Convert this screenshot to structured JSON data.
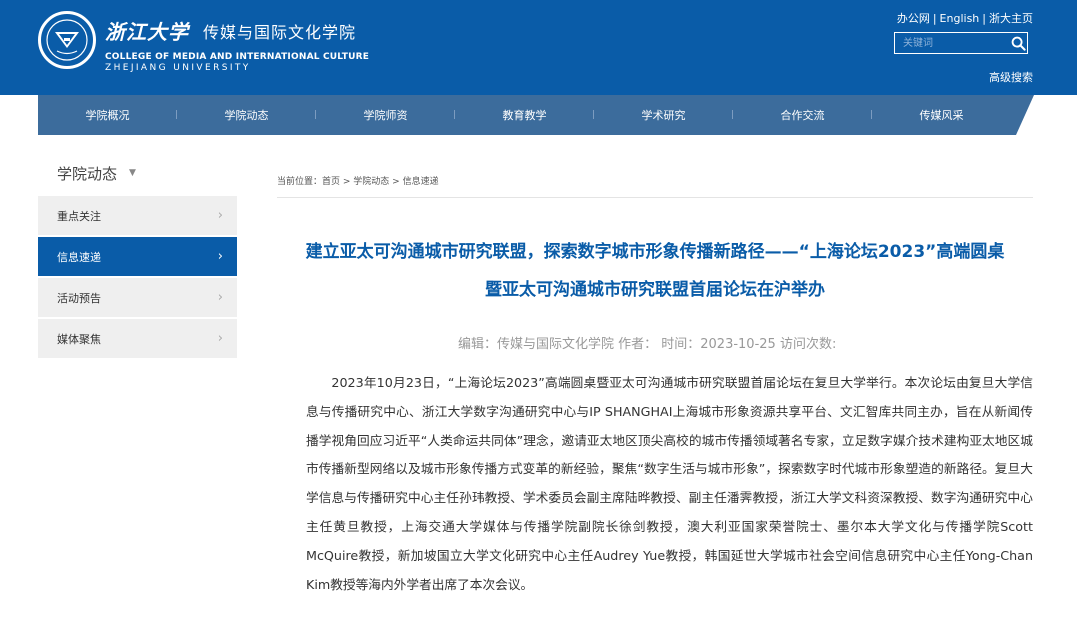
{
  "header": {
    "university_cn": "浙江大学",
    "college_cn": "传媒与国际文化学院",
    "college_en": "COLLEGE OF MEDIA AND INTERNATIONAL CULTURE",
    "university_en": "ZHEJIANG UNIVERSITY",
    "top_links": [
      "办公网",
      "English",
      "浙大主页"
    ],
    "search_placeholder": "关键词",
    "advanced_search": "高级搜索"
  },
  "nav": [
    "学院概况",
    "学院动态",
    "学院师资",
    "教育教学",
    "学术研究",
    "合作交流",
    "传媒风采"
  ],
  "sidebar": {
    "title": "学院动态",
    "items": [
      {
        "label": "重点关注"
      },
      {
        "label": "信息速递",
        "active": true
      },
      {
        "label": "活动预告"
      },
      {
        "label": "媒体聚焦"
      }
    ]
  },
  "breadcrumb": {
    "prefix": "当前位置：",
    "items": [
      "首页",
      "学院动态",
      "信息速递"
    ]
  },
  "article": {
    "title": "建立亚太可沟通城市研究联盟，探索数字城市形象传播新路径——“上海论坛2023”高端圆桌暨亚太可沟通城市研究联盟首届论坛在沪举办",
    "meta": "编辑：传媒与国际文化学院 作者： 时间：2023-10-25 访问次数:",
    "paragraph": "2023年10月23日，“上海论坛2023”高端圆桌暨亚太可沟通城市研究联盟首届论坛在复旦大学举行。本次论坛由复旦大学信息与传播研究中心、浙江大学数字沟通研究中心与IP SHANGHAI上海城市形象资源共享平台、文汇智库共同主办，旨在从新闻传播学视角回应习近平“人类命运共同体”理念，邀请亚太地区顶尖高校的城市传播领域著名专家，立足数字媒介技术建构亚太地区城市传播新型网络以及城市形象传播方式变革的新经验，聚焦“数字生活与城市形象”，探索数字时代城市形象塑造的新路径。复旦大学信息与传播研究中心主任孙玮教授、学术委员会副主席陆晔教授、副主任潘霁教授，浙江大学文科资深教授、数字沟通研究中心主任黄旦教授，上海交通大学媒体与传播学院副院长徐剑教授，澳大利亚国家荣誉院士、墨尔本大学文化与传播学院Scott McQuire教授，新加坡国立大学文化研究中心主任Audrey Yue教授，韩国延世大学城市社会空间信息研究中心主任Yong-Chan Kim教授等海内外学者出席了本次会议。"
  },
  "colors": {
    "brand_blue": "#0a5ca8",
    "nav_blue": "#3c6c9c",
    "sidebar_bg": "#efefef"
  }
}
